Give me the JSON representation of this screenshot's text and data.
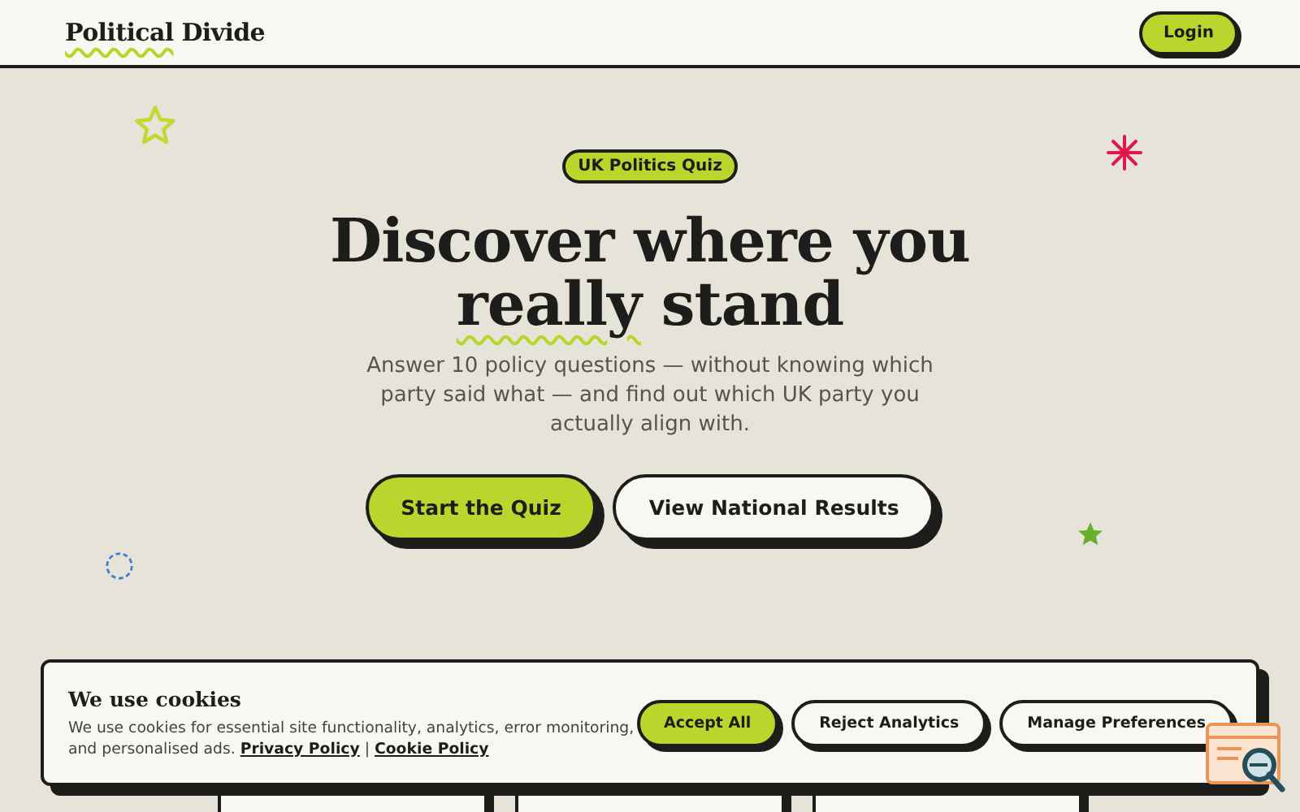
{
  "header": {
    "logo": "*Political* Divide",
    "login": "Login"
  },
  "hero": {
    "badge": "UK Politics Quiz",
    "title_line_1": "Discover where you",
    "title_line_2": "*really* stand",
    "subtitle": "Answer 10 policy questions — without knowing which party said what — and find out which UK party you actually align with.",
    "buttons": [
      {
        "label": "Start the Quiz",
        "kind": "primary"
      },
      {
        "label": "View National Results",
        "kind": "secondary"
      }
    ]
  },
  "cards": [
    {
      "kind": "card"
    },
    {
      "kind": "card"
    },
    {
      "kind": "card"
    }
  ],
  "cookie_banner": {
    "title": "We use cookies",
    "text": "We use cookies for essential site functionality, analytics, error monitoring, and personalised ads.",
    "links": [
      "Privacy Policy",
      "Cookie Policy"
    ],
    "separator": "|",
    "buttons": [
      {
        "label": "Accept All",
        "kind": "primary"
      },
      {
        "label": "Reject Analytics",
        "kind": "secondary"
      },
      {
        "label": "Manage Preferences",
        "kind": "secondary"
      }
    ]
  }
}
